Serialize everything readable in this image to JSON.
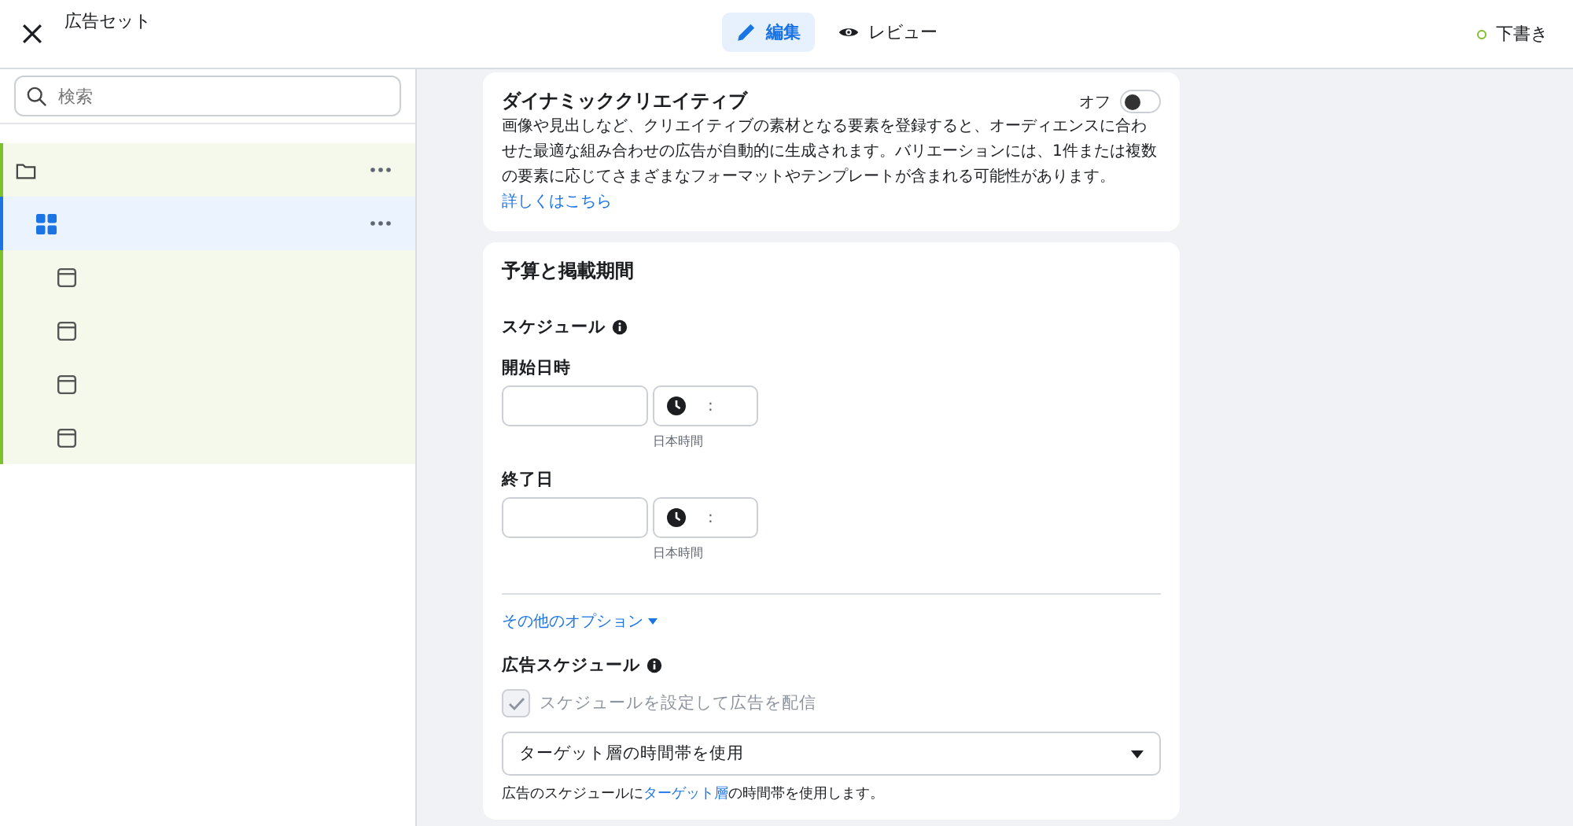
{
  "top_bar": {
    "title": "広告セット",
    "tabs": [
      {
        "label": "編集",
        "kind": "edit",
        "selected": true
      },
      {
        "label": "レビュー",
        "kind": "review",
        "selected": false
      }
    ],
    "status": {
      "label": "下書き",
      "color": "#7cc02b"
    }
  },
  "sidebar": {
    "search": {
      "placeholder": "検索"
    },
    "tree": [
      {
        "kind": "campaign",
        "selected": false,
        "children": [
          {
            "kind": "adset",
            "selected": true,
            "children": [
              {
                "kind": "ad",
                "selected": false
              },
              {
                "kind": "ad",
                "selected": false
              },
              {
                "kind": "ad",
                "selected": false
              },
              {
                "kind": "ad",
                "selected": false
              }
            ]
          }
        ]
      }
    ]
  },
  "dynamic_creative": {
    "title": "ダイナミッククリエイティブ",
    "toggle": {
      "label": "オフ",
      "on": false
    },
    "description": "画像や見出しなど、クリエイティブの素材となる要素を登録すると、オーディエンスに合わせた最適な組み合わせの広告が自動的に生成されます。バリエーションには、1件または複数の要素に応じてさまざまなフォーマットやテンプレートが含まれる可能性があります。",
    "link": "詳しくはこちら"
  },
  "budget": {
    "title": "予算と掲載期間",
    "schedule_heading": "スケジュール",
    "dates": [
      {
        "label": "開始日時",
        "time_separator": ":",
        "timezone": "日本時間"
      },
      {
        "label": "終了日",
        "time_separator": ":",
        "timezone": "日本時間"
      }
    ],
    "more_options": "その他のオプション",
    "ad_schedule_heading": "広告スケジュール",
    "schedule_checkbox": {
      "label": "スケジュールを設定して広告を配信",
      "checked": true,
      "disabled": true
    },
    "timezone_select": {
      "value": "ターゲット層の時間帯を使用"
    },
    "help": {
      "before": "広告のスケジュールに",
      "link": "ターゲット層",
      "after": "の時間帯を使用します。"
    }
  }
}
